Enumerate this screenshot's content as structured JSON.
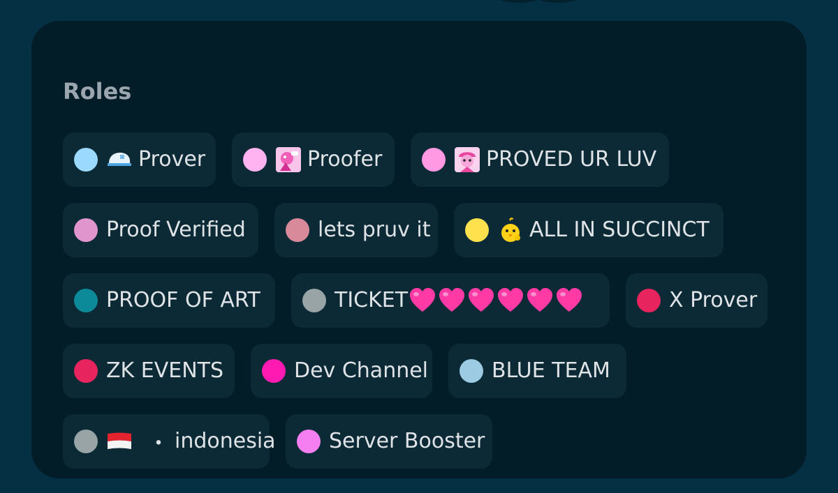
{
  "section": {
    "title": "Roles"
  },
  "roles": [
    {
      "label": "Prover",
      "color": "#9bd9ff",
      "icon": "cap-icon"
    },
    {
      "label": "Proofer",
      "color": "#ffb3f0",
      "icon": "pink-character-icon"
    },
    {
      "label": "PROVED UR LUV",
      "color": "#ff99e3",
      "icon": "pink-cap-character-icon"
    },
    {
      "label": "Proof Verified",
      "color": "#e096cc",
      "icon": ""
    },
    {
      "label": "lets pruv it",
      "color": "#d98a9a",
      "icon": ""
    },
    {
      "label": "ALL IN SUCCINCT",
      "color": "#ffe14d",
      "icon": "yellow-chick-icon"
    },
    {
      "label": "PROOF OF ART",
      "color": "#0c8a99",
      "icon": ""
    },
    {
      "label": "TICKET",
      "color": "#98a4a6",
      "icon": "heart-icon",
      "suffix_icon_count": 6
    },
    {
      "label": "X Prover",
      "color": "#e8245f",
      "icon": ""
    },
    {
      "label": "ZK EVENTS",
      "color": "#e8245f",
      "icon": ""
    },
    {
      "label": "Dev Channel",
      "color": "#ff1ab1",
      "icon": ""
    },
    {
      "label": "BLUE TEAM",
      "color": "#9ccbe3",
      "icon": ""
    },
    {
      "label": "indonesia",
      "color": "#98a4a6",
      "icon": "indonesia-flag-icon",
      "separator": "・"
    },
    {
      "label": "Server Booster",
      "color": "#f57ff1",
      "icon": ""
    }
  ]
}
